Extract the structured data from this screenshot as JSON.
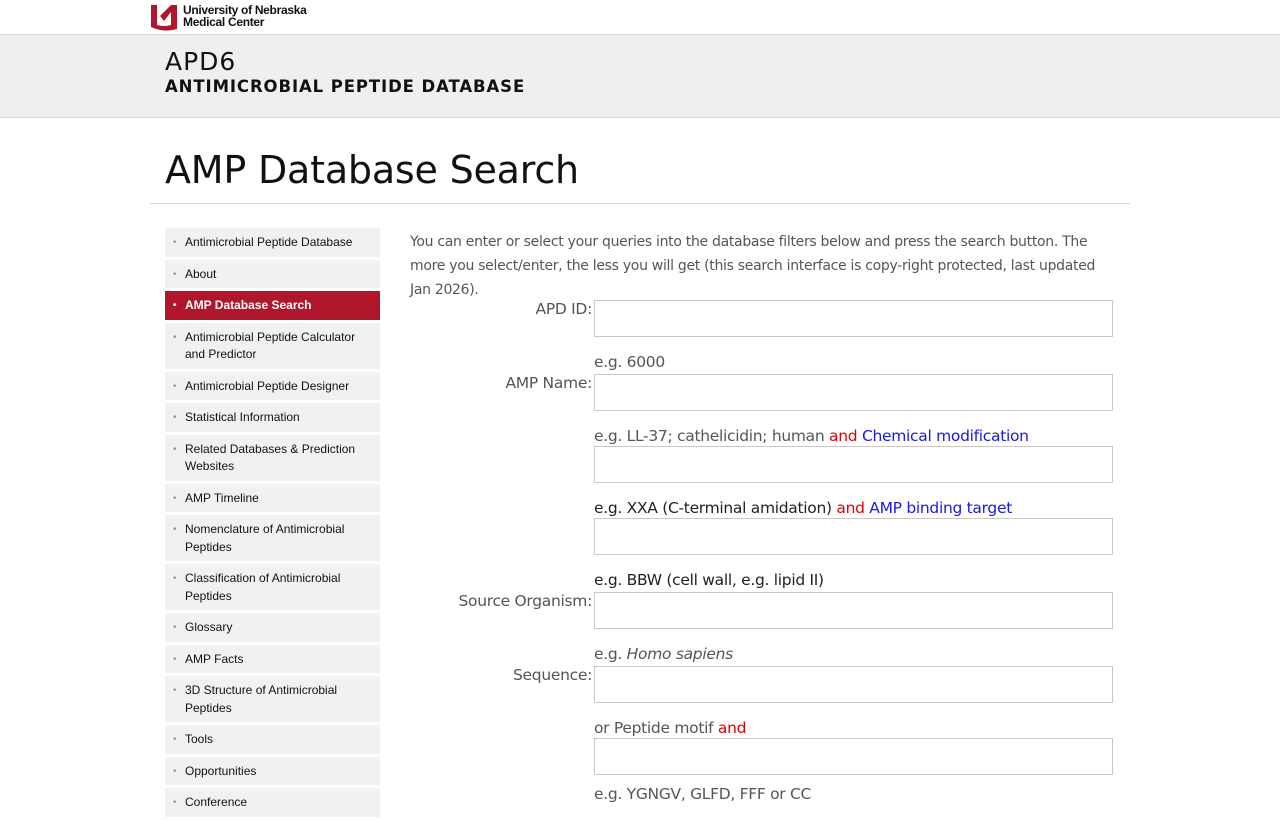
{
  "header": {
    "logo_line1": "University of Nebraska",
    "logo_line2": "Medical Center",
    "site_name": "APD6",
    "site_subtitle": "ANTIMICROBIAL PEPTIDE DATABASE"
  },
  "page": {
    "title": "AMP Database Search"
  },
  "sidebar": {
    "items": [
      {
        "label": "Antimicrobial Peptide Database"
      },
      {
        "label": "About"
      },
      {
        "label": "AMP Database Search"
      },
      {
        "label": "Antimicrobial Peptide Calculator and Predictor"
      },
      {
        "label": "Antimicrobial Peptide Designer"
      },
      {
        "label": "Statistical Information"
      },
      {
        "label": "Related Databases & Prediction Websites"
      },
      {
        "label": "AMP Timeline"
      },
      {
        "label": "Nomenclature of Antimicrobial Peptides"
      },
      {
        "label": "Classification of Antimicrobial Peptides"
      },
      {
        "label": "Glossary"
      },
      {
        "label": "AMP Facts"
      },
      {
        "label": "3D Structure of Antimicrobial Peptides"
      },
      {
        "label": "Tools"
      },
      {
        "label": "Opportunities"
      },
      {
        "label": "Conference"
      }
    ],
    "active_index": 2
  },
  "main": {
    "intro": "You can enter or select your queries into the database filters below and press the search button. The more you select/enter, the less you will get (this search interface is copy-right protected, last updated Jan 2026).",
    "fields": {
      "apd_id": {
        "label": "APD ID:",
        "value": "",
        "help": "e.g. 6000"
      },
      "amp_name": {
        "label": "AMP Name:",
        "value": "",
        "help_pre": "e.g. LL-37; cathelicidin; human",
        "help_and": "and",
        "help_link": "Chemical modification"
      },
      "chem_mod": {
        "value": "",
        "help_pre": "e.g. XXA (C-terminal amidation)",
        "help_and": "and",
        "help_link": "AMP binding target"
      },
      "binding_target": {
        "value": "",
        "help": "e.g. BBW (cell wall, e.g. lipid II)"
      },
      "source_organism": {
        "label": "Source Organism:",
        "value": "",
        "help_pre": "e.g.",
        "help_ital": "Homo sapiens"
      },
      "sequence": {
        "label": "Sequence:",
        "value": "",
        "help_pre": "or Peptide motif",
        "help_and": "and"
      },
      "motif": {
        "value": "",
        "help": "e.g. YGNGV, GLFD, FFF or CC"
      }
    }
  },
  "colors": {
    "brand_red": "#b1172c",
    "accent_red": "#e00000",
    "link_blue": "#1a1ae0"
  }
}
